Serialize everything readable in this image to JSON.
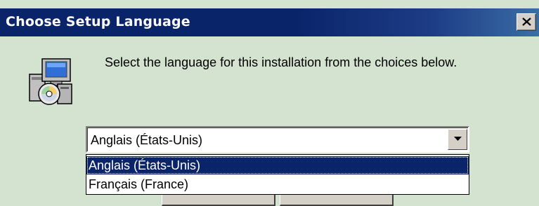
{
  "window": {
    "title": "Choose Setup Language",
    "close_symbol": "x-close-icon"
  },
  "content": {
    "icon": "setup-installer-icon",
    "prompt": "Select the language for this installation from the choices below."
  },
  "language_select": {
    "selected_value": "Anglais (États-Unis)",
    "options": [
      {
        "label": "Anglais (États-Unis)",
        "highlighted": true
      },
      {
        "label": "Français (France)",
        "highlighted": false
      }
    ],
    "dropdown_arrow_icon": "chevron-down-icon"
  },
  "colors": {
    "titlebar": "#0a246a",
    "dialog_bg": "#d4e3d0",
    "selection": "#0a246a"
  }
}
